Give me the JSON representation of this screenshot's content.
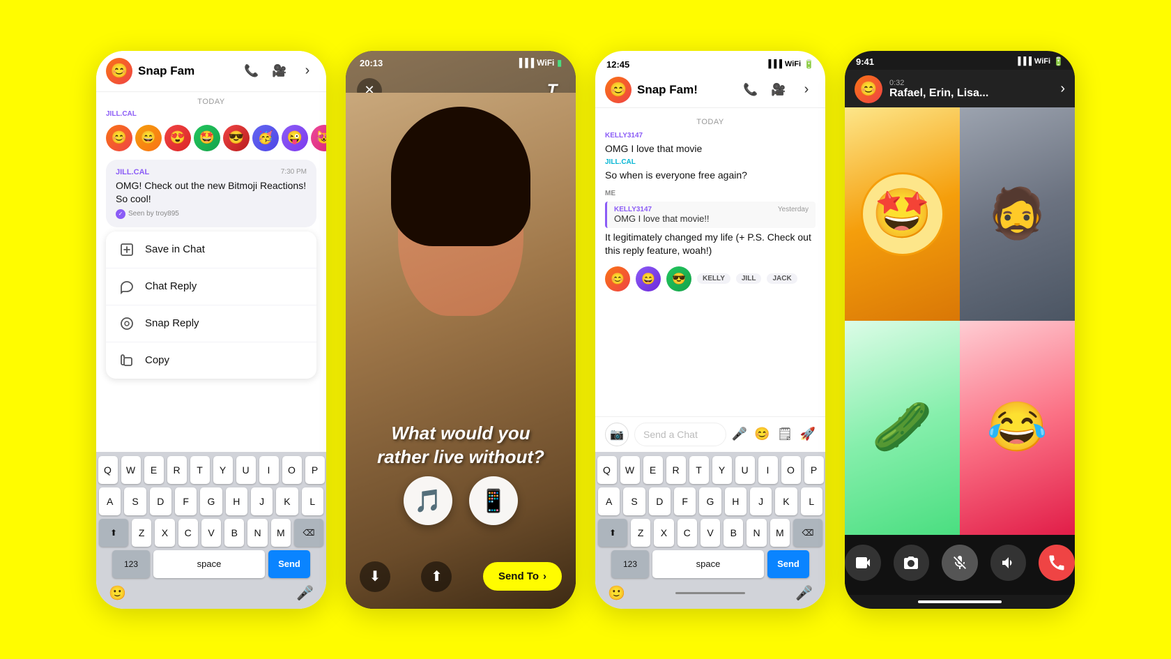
{
  "bg_color": "#FFFC00",
  "phone1": {
    "title": "Snap Fam",
    "today_label": "TODAY",
    "sender_label": "JILL.CAL",
    "message_time": "7:30 PM",
    "message_text": "OMG! Check out the new Bitmoji Reactions! So cool!",
    "seen_text": "Seen by troy895",
    "context_menu": [
      {
        "id": "save-in-chat",
        "icon": "💾",
        "label": "Save in Chat"
      },
      {
        "id": "chat-reply",
        "icon": "↩",
        "label": "Chat Reply"
      },
      {
        "id": "snap-reply",
        "icon": "⊙",
        "label": "Snap Reply"
      },
      {
        "id": "copy",
        "icon": "⧉",
        "label": "Copy"
      }
    ],
    "keyboard": {
      "rows": [
        [
          "Q",
          "W",
          "E",
          "R",
          "T",
          "Y",
          "U",
          "I",
          "O",
          "P"
        ],
        [
          "A",
          "S",
          "D",
          "F",
          "G",
          "H",
          "J",
          "K",
          "L"
        ],
        [
          "⬆",
          "Z",
          "X",
          "C",
          "V",
          "B",
          "N",
          "M",
          "⌫"
        ],
        [
          "123",
          "space",
          "Send"
        ]
      ]
    }
  },
  "phone2": {
    "status_time": "20:13",
    "snap_text": "What would you rather live without?",
    "choice1": "🎵",
    "choice2": "📱",
    "send_to_label": "Send To"
  },
  "phone3": {
    "status_time": "12:45",
    "title": "Snap Fam!",
    "today_label": "TODAY",
    "messages": [
      {
        "sender": "KELLY3147",
        "sender_color": "purple",
        "text": "OMG I love that movie"
      },
      {
        "sender": "JILL.CAL",
        "sender_color": "teal",
        "text": "So when is everyone free again?"
      }
    ],
    "me_label": "ME",
    "reply_card": {
      "sender": "KELLY3147",
      "time": "Yesterday",
      "text": "OMG I love that movie!!"
    },
    "my_message": "It legitimately changed my life (+ P.S. Check out this reply feature, woah!)",
    "reaction_users": [
      "KELLY",
      "JILL",
      "JACK"
    ],
    "input_placeholder": "Send a Chat",
    "keyboard": {
      "rows": [
        [
          "Q",
          "W",
          "E",
          "R",
          "T",
          "Y",
          "U",
          "I",
          "O",
          "P"
        ],
        [
          "A",
          "S",
          "D",
          "F",
          "G",
          "H",
          "J",
          "K",
          "L"
        ],
        [
          "⬆",
          "Z",
          "X",
          "C",
          "V",
          "B",
          "N",
          "M",
          "⌫"
        ],
        [
          "123",
          "space",
          "Send"
        ]
      ]
    }
  },
  "phone4": {
    "timer": "0:32",
    "name": "Rafael, Erin, Lisa...",
    "controls": [
      "📷",
      "📱",
      "🎤",
      "🔊",
      "📞"
    ]
  }
}
